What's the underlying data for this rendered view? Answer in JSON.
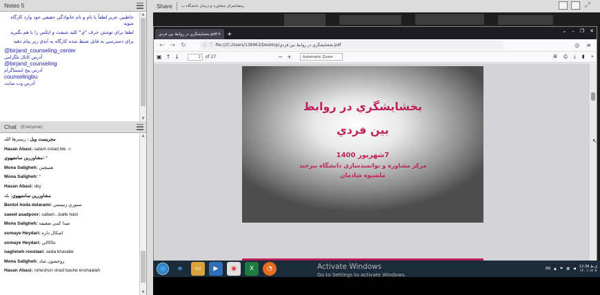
{
  "notes": {
    "title": "Notes 5",
    "lines": [
      "خاطبين عزيز لطفاً با نام و نام خانوادگي حقيقي خود وارد كارگاه شويد",
      "لطفا براي نوشتن حرف \"ي\" كليد شيفت و ايكس را با هم بگيريد",
      "براي دسترسي به فايل ضبط شده كارگاه به آيدي زير پيام دهيد"
    ],
    "links": [
      {
        "text": "@birjand_counseling_center",
        "caption": "آدرس كانال تلگرامي"
      },
      {
        "text": "@birjand_counseling",
        "caption": "آدرس پيج اينستاگرام"
      },
      {
        "text": "counselingbu",
        "caption": "آدرس وب سايت"
      }
    ]
  },
  "chat": {
    "title": "Chat",
    "scope": "(Everyone)",
    "messages": [
      {
        "name": "مجريست ويل :",
        "text": "ريسرها الله"
      },
      {
        "name": "Hasan Abasi:",
        "text": "salam ostad ble ☺"
      },
      {
        "name": "مشاوررين سامتيهوي:",
        "text": "*"
      },
      {
        "name": "Mona Saligheh:",
        "text": "هميچين"
      },
      {
        "name": "Mona Saligheh:",
        "text": "*"
      },
      {
        "name": "Hasan Abasi:",
        "text": "oky"
      },
      {
        "name": "مشاوررين سامتيهوي:",
        "text": "بله"
      },
      {
        "name": "Bentol hoda delarami:",
        "text": "ستوري زنيستي"
      },
      {
        "name": "saeed asadpoor:",
        "text": "sallam...balle hast"
      },
      {
        "name": "Mona Saligheh:",
        "text": "صدا كمي ضعيفه"
      },
      {
        "name": "somaye Heydari:",
        "text": "اشكال داره"
      },
      {
        "name": "somaye Heydari:",
        "text": "عااااالي"
      },
      {
        "name": "naghmeh roostaei:",
        "text": "seda kharabe"
      },
      {
        "name": "Mona Saligheh:",
        "text": "روحشون شاد"
      },
      {
        "name": "Hasan Abasi:",
        "text": "roheshon shad bashe enshaalah"
      }
    ]
  },
  "share": {
    "label": "Share",
    "title": "رمضانمركز مشاوره و درمان دانشگاه ب"
  },
  "browser": {
    "tab_title": "بخشايشگري در روابط بين فردي.pdf",
    "url": "file:///C:/Users/138963/Desktop/بخشايشگري در روابط بين فردي.pdf",
    "page_current": "2",
    "page_total": "of 27",
    "zoom": "Automatic Zoom"
  },
  "slide": {
    "title_line1": "بخشايشگري در روابط",
    "title_line2": "بين فردي",
    "date": "7شهريور 1400",
    "center": "مركز مشاوره و توانمندسازي دانشگاه بيرجند",
    "presenter": "ملشيوه شادمان"
  },
  "taskbar": {
    "lang": "EN",
    "time": "12:39 ق.ظ",
    "date": "۱۴۰۰/۰۶/۰۷"
  },
  "activation": {
    "title": "Activate Windows",
    "subtitle": "Go to Settings to activate Windows."
  },
  "colors": {
    "slide_accent": "#c0205a",
    "note_text": "#1a1ab0",
    "taskbar": "#1c2b3a"
  }
}
